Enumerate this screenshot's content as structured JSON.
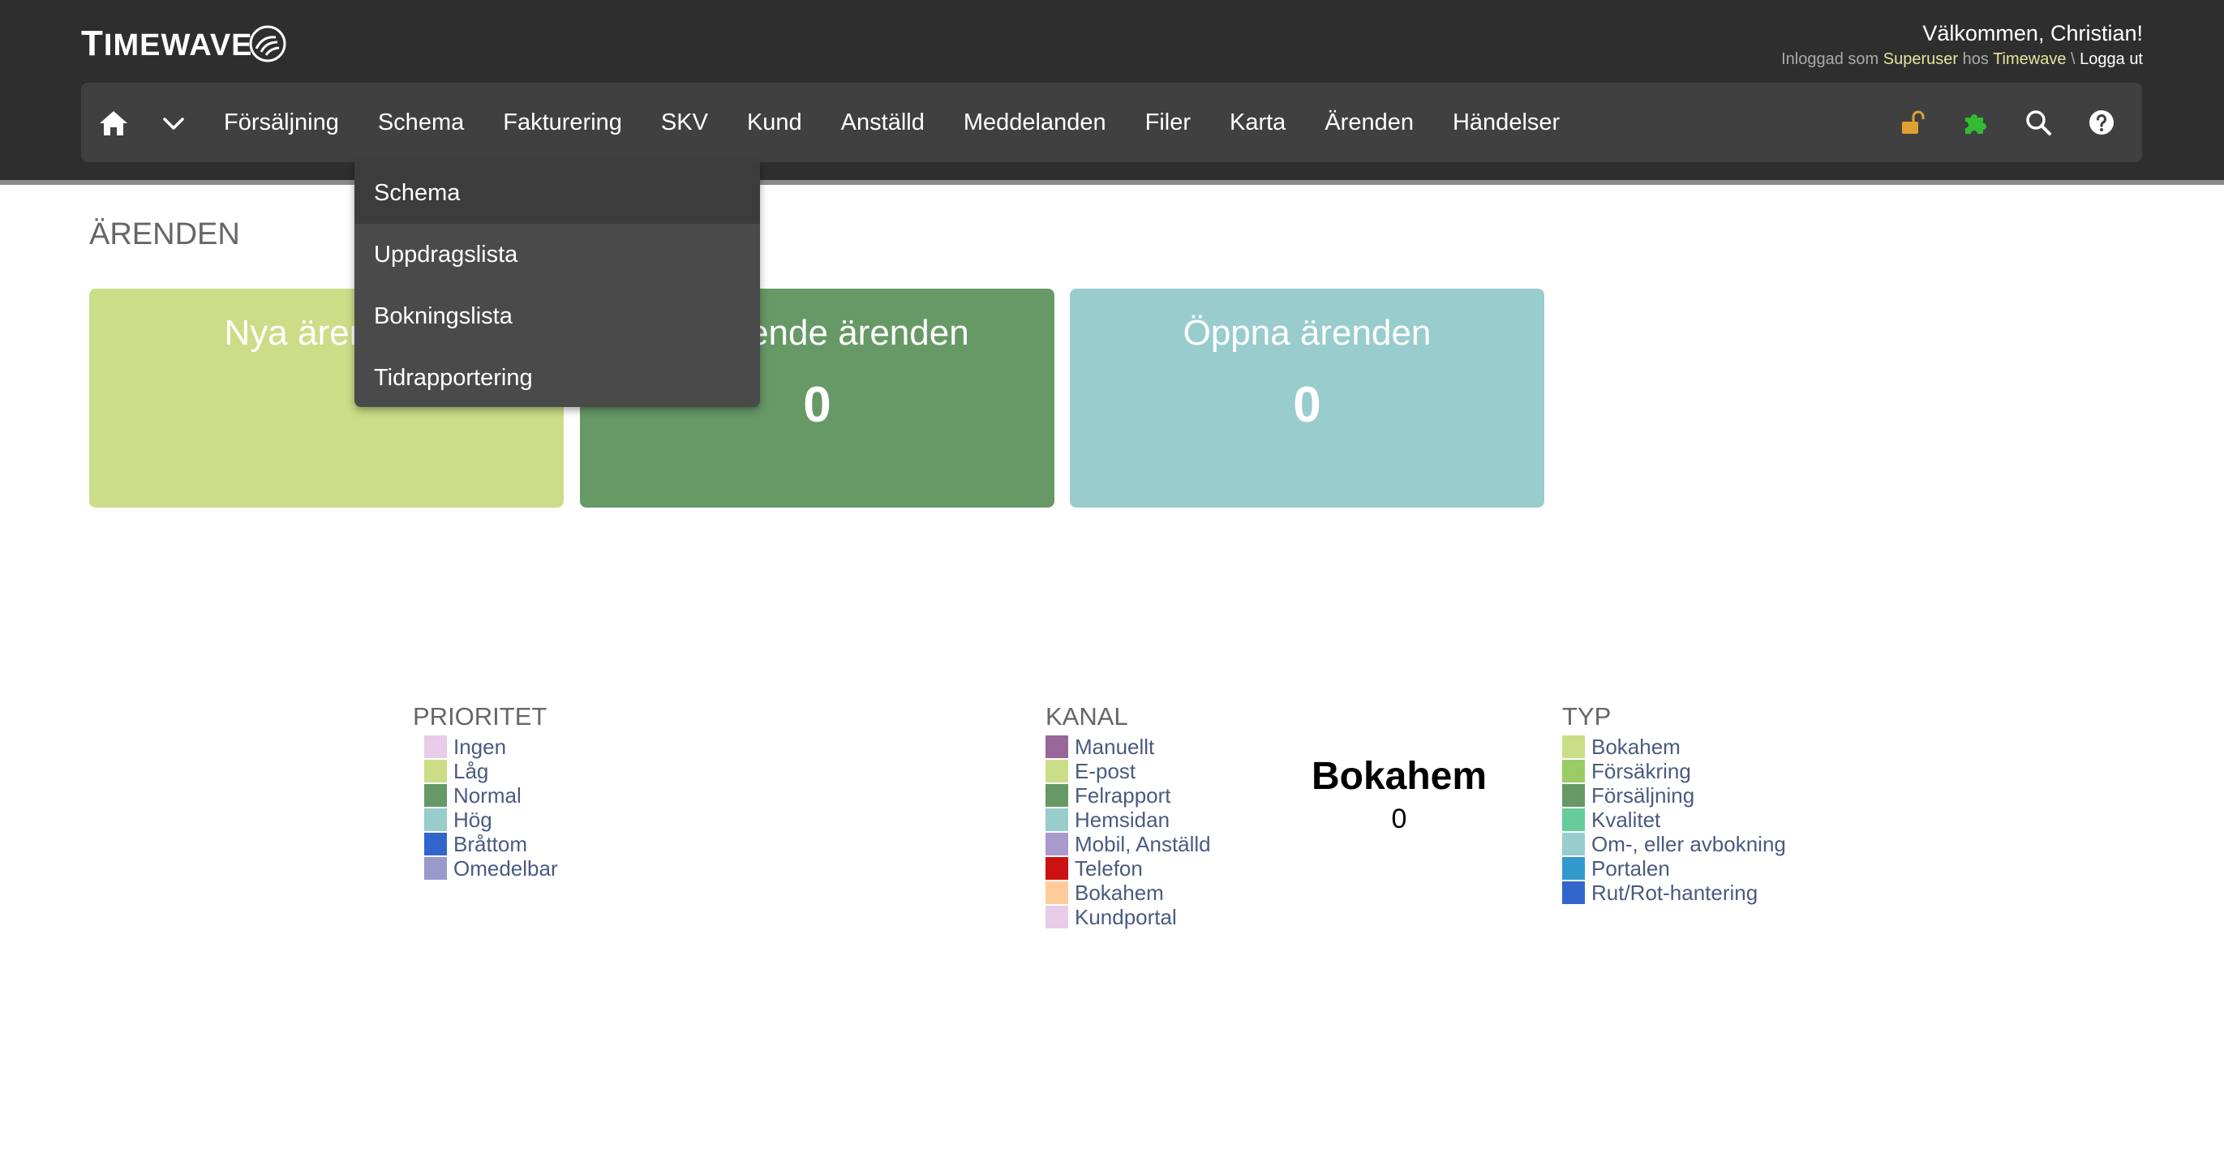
{
  "header": {
    "logo_text_first": "T",
    "logo_text_rest": "IMEWAVE",
    "welcome": "Välkommen, Christian!",
    "login_prefix": "Inloggad som",
    "login_role": "Superuser",
    "login_mid": "hos",
    "login_company": "Timewave",
    "login_sep": "\\",
    "logout": "Logga ut"
  },
  "nav": {
    "items": [
      "Försäljning",
      "Schema",
      "Fakturering",
      "SKV",
      "Kund",
      "Anställd",
      "Meddelanden",
      "Filer",
      "Karta",
      "Ärenden",
      "Händelser"
    ],
    "right_icons": [
      "unlock-icon",
      "puzzle-icon",
      "search-icon",
      "help-icon"
    ]
  },
  "dropdown": {
    "items": [
      "Schema",
      "Uppdragslista",
      "Bokningslista",
      "Tidrapportering"
    ]
  },
  "page": {
    "title": "ÄRENDEN",
    "cards": [
      {
        "title": "Nya ärenden",
        "count": "",
        "color": "#ccdd88"
      },
      {
        "title": "Pågående ärenden",
        "count": "0",
        "color": "#669966"
      },
      {
        "title": "Öppna ärenden",
        "count": "0",
        "color": "#99cccc"
      }
    ]
  },
  "legends": {
    "prioritet": {
      "title": "PRIORITET",
      "items": [
        {
          "label": "Ingen",
          "color": "#e8cce8"
        },
        {
          "label": "Låg",
          "color": "#ccdd88"
        },
        {
          "label": "Normal",
          "color": "#669966"
        },
        {
          "label": "Hög",
          "color": "#99cccc"
        },
        {
          "label": "Bråttom",
          "color": "#3366cc"
        },
        {
          "label": "Omedelbar",
          "color": "#9999cc"
        }
      ]
    },
    "kanal": {
      "title": "KANAL",
      "items": [
        {
          "label": "Manuellt",
          "color": "#996699"
        },
        {
          "label": "E-post",
          "color": "#ccdd88"
        },
        {
          "label": "Felrapport",
          "color": "#669966"
        },
        {
          "label": "Hemsidan",
          "color": "#99cccc"
        },
        {
          "label": "Mobil, Anställd",
          "color": "#aa99cc"
        },
        {
          "label": "Telefon",
          "color": "#cc1111"
        },
        {
          "label": "Bokahem",
          "color": "#ffcc99"
        },
        {
          "label": "Kundportal",
          "color": "#e8cce8"
        }
      ]
    },
    "typ": {
      "title": "TYP",
      "items": [
        {
          "label": "Bokahem",
          "color": "#ccdd88"
        },
        {
          "label": "Försäkring",
          "color": "#99cc66"
        },
        {
          "label": "Försäljning",
          "color": "#669966"
        },
        {
          "label": "Kvalitet",
          "color": "#66cc99"
        },
        {
          "label": "Om-, eller avbokning",
          "color": "#99cccc"
        },
        {
          "label": "Portalen",
          "color": "#3399cc"
        },
        {
          "label": "Rut/Rot-hantering",
          "color": "#3366cc"
        }
      ]
    }
  },
  "center_stat": {
    "title": "Bokahem",
    "count": "0"
  }
}
